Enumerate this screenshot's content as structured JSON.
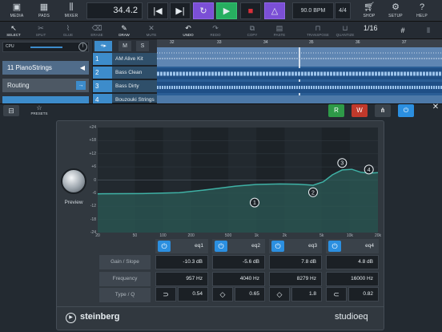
{
  "toolbar": {
    "media": "MEDIA",
    "pads": "PADS",
    "mixer": "MIXER",
    "position": "34.4.2",
    "bpm": "90.0 BPM",
    "signature": "4/4",
    "shop": "SHOP",
    "setup": "SETUP",
    "help": "HELP"
  },
  "tools": {
    "select": "SELECT",
    "split": "SPLIT",
    "glue": "GLUE",
    "erase": "ERASE",
    "draw": "DRAW",
    "mute": "MUTE",
    "undo": "UNDO",
    "redo": "REDO",
    "copy": "COPY",
    "paste": "PASTE",
    "transpose": "TRANSPOSE",
    "quantize": "QUANTIZE",
    "quantize_value": "1/16"
  },
  "tracks": {
    "cpu": "CPU",
    "selected_num": "11",
    "selected_name": "PianoStrings",
    "routing": "Routing",
    "m": "M",
    "s": "S",
    "rows": [
      {
        "num": "1",
        "name": "AM Alive Kit"
      },
      {
        "num": "2",
        "name": "Bass Clean"
      },
      {
        "num": "3",
        "name": "Bass Dirty"
      },
      {
        "num": "4",
        "name": "Bouzouki Strings"
      }
    ],
    "ruler": [
      "32",
      "33",
      "34",
      "35",
      "36",
      "37"
    ]
  },
  "eq": {
    "presets": "PRESETS",
    "r": "R",
    "w": "W",
    "preview": "Preview",
    "db_ticks": [
      "+24",
      "+18",
      "+12",
      "+6",
      "0",
      "-6",
      "-12",
      "-18",
      "-24"
    ],
    "hz_ticks": [
      "20",
      "50",
      "100",
      "200",
      "500",
      "1k",
      "2k",
      "5k",
      "10k",
      "20k"
    ],
    "row_labels": {
      "gain": "Gain / Slope",
      "freq": "Frequency",
      "type": "Type / Q"
    },
    "bands": [
      {
        "name": "eq1",
        "gain": "-10.3 dB",
        "freq": "957 Hz",
        "type": "low-shelf-icon",
        "type_glyph": "⊃",
        "q": "0.54"
      },
      {
        "name": "eq2",
        "gain": "-5.6 dB",
        "freq": "4040 Hz",
        "type": "peak-icon",
        "type_glyph": "◇",
        "q": "0.65"
      },
      {
        "name": "eq3",
        "gain": "7.8 dB",
        "freq": "8279 Hz",
        "type": "peak-icon",
        "type_glyph": "◇",
        "q": "1.8"
      },
      {
        "name": "eq4",
        "gain": "4.8 dB",
        "freq": "16000 Hz",
        "type": "high-shelf-icon",
        "type_glyph": "⊂",
        "q": "0.82"
      }
    ],
    "brand": "steinberg",
    "product": "studioeq"
  },
  "colors": {
    "accent": "#2b8fe0",
    "record": "#c0392b",
    "play": "#27ae60",
    "loop": "#7b4fd6",
    "curve": "#3fb1a5"
  }
}
